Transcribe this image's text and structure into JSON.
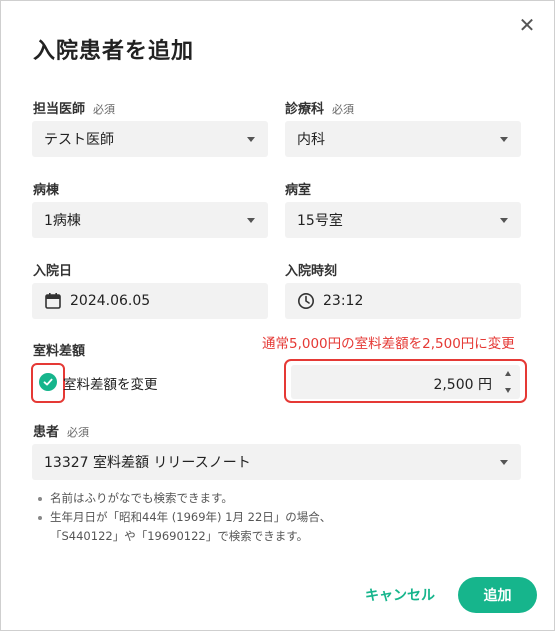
{
  "dialog": {
    "title": "入院患者を追加",
    "close_glyph": "✕"
  },
  "form": {
    "doctor": {
      "label": "担当医師",
      "required": "必須",
      "value": "テスト医師"
    },
    "department": {
      "label": "診療科",
      "required": "必須",
      "value": "内科"
    },
    "ward": {
      "label": "病棟",
      "value": "1病棟"
    },
    "room": {
      "label": "病室",
      "value": "15号室"
    },
    "admission_date": {
      "label": "入院日",
      "value": "2024.06.05",
      "icon": "calendar-icon"
    },
    "admission_time": {
      "label": "入院時刻",
      "value": "23:12",
      "icon": "clock-icon"
    },
    "room_fee": {
      "label": "室料差額",
      "checkbox_label": "室料差額を変更",
      "checked": true,
      "value": "2,500",
      "unit": "円"
    },
    "patient": {
      "label": "患者",
      "required": "必須",
      "value": "13327 室料差額 リリースノート"
    }
  },
  "annotation": {
    "text": "通常5,000円の室料差額を2,500円に変更",
    "color": "#e53935"
  },
  "notes": [
    "名前はふりがなでも検索できます。",
    "生年月日が「昭和44年 (1969年) 1月 22日」の場合、",
    "「S440122」や「19690122」で検索できます。"
  ],
  "actions": {
    "cancel": "キャンセル",
    "submit": "追加"
  },
  "colors": {
    "accent": "#16b58c",
    "field_bg": "#f2f2f2",
    "annotation_red": "#e53935"
  }
}
